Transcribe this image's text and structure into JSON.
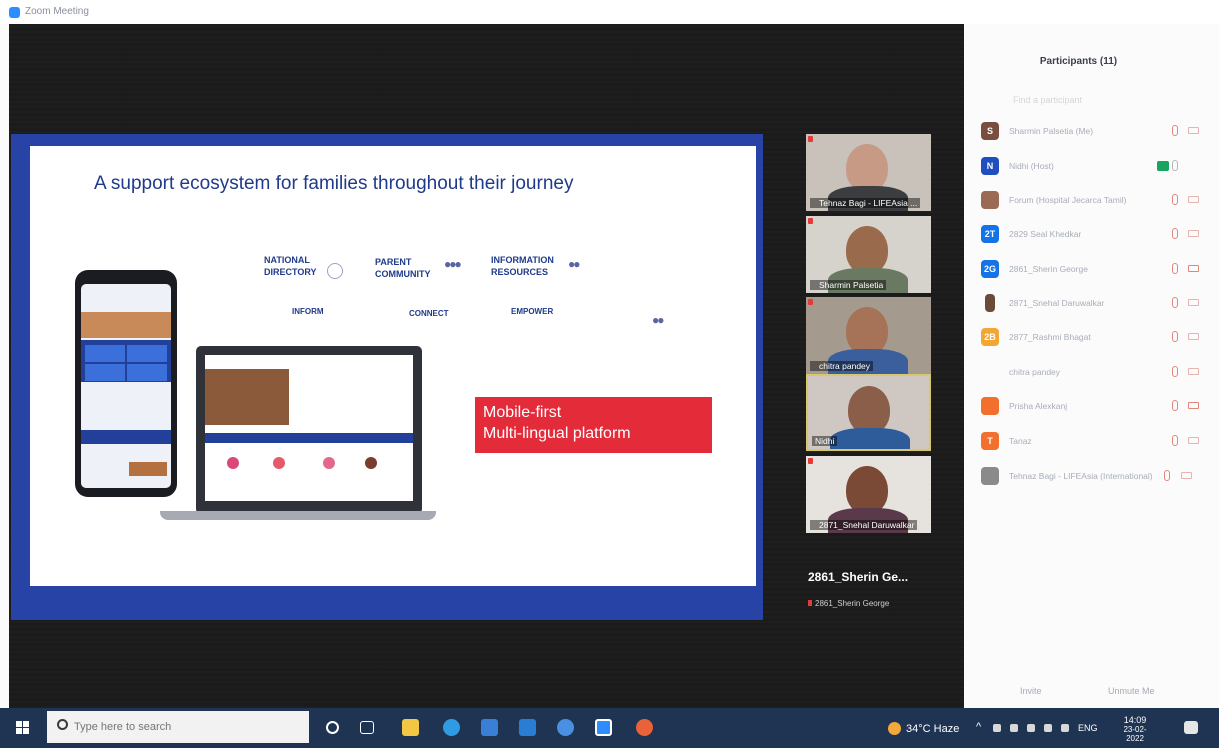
{
  "window": {
    "title": "Zoom Meeting",
    "minimize": "–",
    "maximize": "❐",
    "close": "×"
  },
  "slide": {
    "title": "A support ecosystem for families throughout their journey",
    "features": [
      {
        "label": "NATIONAL\nDIRECTORY"
      },
      {
        "label": "PARENT\nCOMMUNITY"
      },
      {
        "label": "INFORMATION\nRESOURCES"
      }
    ],
    "pillars": [
      "INFORM",
      "CONNECT",
      "EMPOWER"
    ],
    "highlight_line1": "Mobile-first",
    "highlight_line2": "Multi-lingual platform",
    "highlight_color": "#e32b3a"
  },
  "gallery": {
    "tiles": [
      {
        "name": "Tehnaz Bagi - LIFEAsia ..."
      },
      {
        "name": "Sharmin Palsetia"
      },
      {
        "name": "chitra pandey"
      },
      {
        "name": "Nidhi"
      },
      {
        "name": "2871_Snehal Daruwalkar"
      }
    ],
    "active_speaker_name": "2861_Sherin Ge...",
    "active_speaker_sub": "2861_Sherin George"
  },
  "participants": {
    "title": "Participants (11)",
    "hint": "Find a participant",
    "list": [
      {
        "initial": "S",
        "color": "#7a4e3f",
        "name": "Sharmin Palsetia (Me)"
      },
      {
        "initial": "N",
        "color": "#1f4fbf",
        "name": "Nidhi (Host)"
      },
      {
        "initial": "",
        "color": "#9b6a55",
        "name": "Forum (Hospital Jecarca Tamil)"
      },
      {
        "initial": "2T",
        "color": "#1473e6",
        "name": "2829 Seal Khedkar"
      },
      {
        "initial": "2G",
        "color": "#1473e6",
        "name": "2861_Sherin George"
      },
      {
        "initial": "",
        "color": "#6b4a3a",
        "name": "2871_Snehal Daruwalkar"
      },
      {
        "initial": "2B",
        "color": "#f2a735",
        "name": "2877_Rashmi Bhagat"
      },
      {
        "initial": "",
        "color": "#fbfbfb",
        "name": "chitra pandey"
      },
      {
        "initial": "",
        "color": "#f26f2e",
        "name": "Prisha Alexkanj"
      },
      {
        "initial": "T",
        "color": "#f26f2e",
        "name": "Tanaz"
      },
      {
        "initial": "",
        "color": "#8a8a8a",
        "name": "Tehnaz Bagi - LIFEAsia (International)"
      }
    ],
    "invite": "Invite",
    "unmute": "Unmute Me"
  },
  "taskbar": {
    "search_placeholder": "Type here to search",
    "weather": "34°C Haze",
    "language": "ENG",
    "time": "14:09",
    "date": "23-02-2022"
  },
  "icons": [
    "zoom-app-icon",
    "windows-start-icon",
    "search-icon",
    "cortana-icon",
    "task-view-icon",
    "file-explorer-icon",
    "edge-icon",
    "store-icon",
    "mail-icon",
    "chrome-icon",
    "zoom-taskbar-icon",
    "paint-icon",
    "weather-icon",
    "notification-icon"
  ]
}
